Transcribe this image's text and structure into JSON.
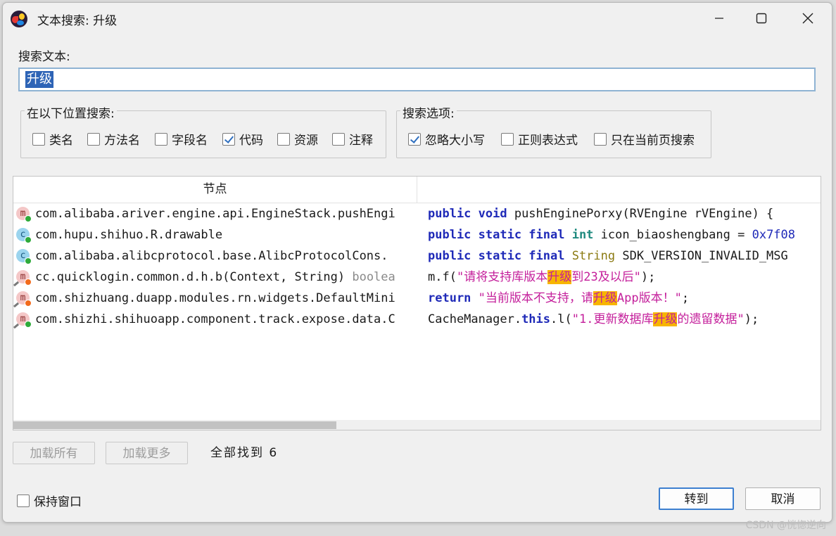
{
  "window": {
    "title": "文本搜索: 升级"
  },
  "search": {
    "label": "搜索文本:",
    "value": "升级"
  },
  "search_in": {
    "legend": "在以下位置搜索:",
    "options": [
      {
        "label": "类名",
        "checked": false
      },
      {
        "label": "方法名",
        "checked": false
      },
      {
        "label": "字段名",
        "checked": false
      },
      {
        "label": "代码",
        "checked": true
      },
      {
        "label": "资源",
        "checked": false
      },
      {
        "label": "注释",
        "checked": false
      }
    ]
  },
  "search_options": {
    "legend": "搜索选项:",
    "options": [
      {
        "label": "忽略大小写",
        "checked": true
      },
      {
        "label": "正则表达式",
        "checked": false
      },
      {
        "label": "只在当前页搜索",
        "checked": false
      }
    ]
  },
  "results": {
    "column_node": "节点",
    "rows": [
      {
        "icon": "m",
        "node": "com.alibaba.ariver.engine.api.EngineStack.pushEngi",
        "code": [
          [
            "kw",
            "public void "
          ],
          [
            "",
            "pushEnginePorxy(RVEngine rVEngine) {"
          ]
        ]
      },
      {
        "icon": "c",
        "node": "com.hupu.shihuo.R.drawable",
        "code": [
          [
            "kw",
            "public static final "
          ],
          [
            "kw2",
            "int "
          ],
          [
            "",
            "icon_biaoshengbang = "
          ],
          [
            "num",
            "0x7f08"
          ]
        ]
      },
      {
        "icon": "c",
        "node": "com.alibaba.alibcprotocol.base.AlibcProtocolCons.",
        "code": [
          [
            "kw",
            "public static final "
          ],
          [
            "type",
            "String "
          ],
          [
            "",
            "SDK_VERSION_INVALID_MSG"
          ]
        ]
      },
      {
        "icon": "m",
        "node": "cc.quicklogin.common.d.h.b(Context, String) ",
        "node_suffix": "boolea",
        "code": [
          [
            "",
            "m.f("
          ],
          [
            "str",
            "\"请将支持库版本"
          ],
          [
            "hl",
            "升级"
          ],
          [
            "str",
            "到23及以后\""
          ],
          [
            "",
            ");"
          ]
        ]
      },
      {
        "icon": "m",
        "node": "com.shizhuang.duapp.modules.rn.widgets.DefaultMini",
        "code": [
          [
            "kw",
            "return "
          ],
          [
            "str",
            "\"当前版本不支持，请"
          ],
          [
            "hl",
            "升级"
          ],
          [
            "str",
            "App版本！\""
          ],
          [
            "",
            ";"
          ]
        ]
      },
      {
        "icon": "m",
        "node": "com.shizhi.shihuoapp.component.track.expose.data.C",
        "code": [
          [
            "",
            "CacheManager."
          ],
          [
            "kw",
            "this"
          ],
          [
            "",
            ".l("
          ],
          [
            "str",
            "\"1.更新数据库"
          ],
          [
            "hl",
            "升级"
          ],
          [
            "str",
            "的遗留数据\""
          ],
          [
            "",
            ");"
          ]
        ]
      }
    ],
    "scroll_fraction": 0.4
  },
  "buttons": {
    "load_all": "加载所有",
    "load_more": "加载更多",
    "goto": "转到",
    "cancel": "取消"
  },
  "status": {
    "found_text": "全部找到 6"
  },
  "keep_window": {
    "label": "保持窗口",
    "checked": false
  },
  "watermark": "CSDN @恍惚逆向"
}
